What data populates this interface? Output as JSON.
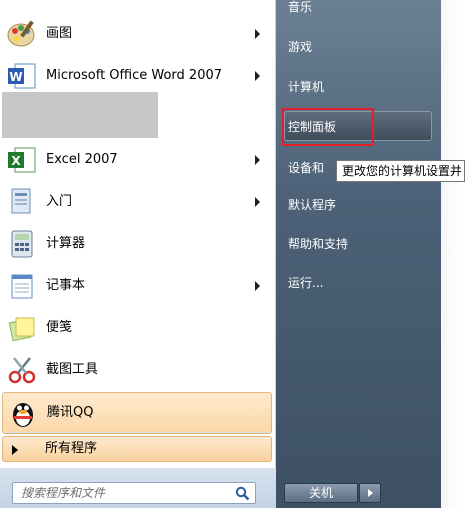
{
  "programs": [
    {
      "label": "画图",
      "icon": "paint-icon"
    },
    {
      "label": "Microsoft Office Word 2007",
      "icon": "word-icon"
    },
    {
      "label": "Excel 2007",
      "icon": "excel-icon"
    },
    {
      "label": "入门",
      "icon": "getting-started-icon"
    },
    {
      "label": "计算器",
      "icon": "calculator-icon"
    },
    {
      "label": "记事本",
      "icon": "notepad-icon"
    },
    {
      "label": "便笺",
      "icon": "sticky-notes-icon"
    },
    {
      "label": "截图工具",
      "icon": "snipping-tool-icon"
    },
    {
      "label": "腾讯QQ",
      "icon": "qq-penguin-icon"
    }
  ],
  "all_programs": {
    "label": "所有程序"
  },
  "search": {
    "placeholder": "搜索程序和文件"
  },
  "right_pane": {
    "items": [
      "音乐",
      "游戏",
      "计算机",
      "控制面板",
      "设备和",
      "默认程序",
      "帮助和支持",
      "运行..."
    ]
  },
  "tooltip": {
    "text": "更改您的计算机设置并"
  },
  "shutdown": {
    "label": "关机"
  },
  "colors": {
    "right_pane": "#4c6177",
    "highlight": "#fbd8a9",
    "annotation_red": "#e0202a"
  }
}
